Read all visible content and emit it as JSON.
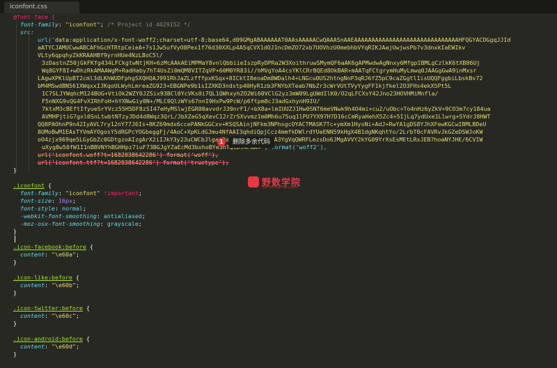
{
  "tab": {
    "title": "iconfont.css"
  },
  "code": {
    "l1": "@font-face {",
    "l2_prop": "font-family",
    "l2_val": "\"iconfont\"",
    "l2_comment": "/* Project id 4029152 */",
    "l3": "src:",
    "l4_prefix": "url('",
    "l4": "data:application/x-font-woff2;charset=utf-8;base64,d09GMgABAAAAAAT0AAsAAAAACwQAAASnAAEAAAAAAAAAAAAAAAAAAAAAAAAAAAAAAHFQGYACDGgqJJId",
    "l5": "aATYCJAMUCwwABCAFhGcHTRtpCeieA+7s1Jw5ufVyO8Pex1f76d30XXLp4A5qCVX1dOJ1ncDmZO72xb7UOVhzU0mebhbVYqRIKJAajUwjwsPb7v3dnxkIaEWIkv",
    "l6": "VLty6qpqhyZkKRAAHBf9yrnHUe4NzLBoC5l/",
    "l7": "3zDastnZ50jGkFKfg434LFCkgtwNtjKH+6zMcAAkAEiMPMaY8vnlQbbiieIszpRyDPRa2W3XoithruwSMymQF6aAK6gAPMwdwAgNnxy6MfgpIBMLgCzlkK6tXB86Uj",
    "l8": "Wq8GYF8I+wDhzRkAMAAWgM+RadHaby7hT4UsZi0mQM8VITZqVP+60M0YR83i//hMVgYoA4csYKlCRrBQEd8OkBAR+mAATqFCtgrymHuMyLmwq0JAAGgGwA9inMxsr",
    "l9": "LAgwXPKlUpBT2cml3dLKhWUDFphgSXQHQAJ991RhJaZLzfffpxKSqx+8ICktI8eoaDm8WDalh4+LNGcu0US2htngNnP3qRJ6fZ5pC9caZGgtl1isUQQFggbiLbskBv72",
    "l10": "bM4MSwdBN561XWqxxIJKqoULWyhLmreaZG923+EBGNPe9b1sIZXKD3ndstp40HyR1zb3FNYbXTeab7NbZr3cWrVUtTVyYygFF1kjfkel2O3FHs4ekX5Pt5L",
    "l11": "1C7SLJYWqhcM124BUG+VtiOk2WZY0JZSix93BCl0YcVKs0i7QL1QWhxyhZO2Wi60VClG2yz3mW09LgUWdIlK0/O2qLFCXsY42Jno23HOVHMiMnfla/",
    "l12": "F5nNXG9vQG4FvXIRhFoH+hYXNwGiy0N+/MLC0QlzWYs67nnI9HxPw9PcW/p6ftpm8cJ3adGxhynH9IU/",
    "l13": "7ktxM3cBEftIfyueSrYVcz55H5DF8zSI47eHyMSlwjEGR08avvdrJ39nrF1/+bX8a+lmIUUZJ1Hw0SNT6meVNwk9h4O4mi+cu2/uObc+To4nHz6yZkV+9CO3m7cy184ua",
    "l14": "AVMHPjtiG7gxl0SnLtwbtNTzyJDd4d8Wqz3QrL/JbXZeG5qXevC12rZrSXvvmzIm0Mh6u75uq1lPU7YX97H7D16cCmRyaHehX5Zc4+5IjLq7ydUxe1Llwrg+5YdrJ8HWT",
    "l15": "QQ8PAOhnP9n42IyAVL7ry12nY77J6Is+8KZ69mdx6ccePANkGGCxv+KSQSAinjNFkm3NPhsgcOYACTMASK7Tc+ymXm1HysNi+AdJ+RwYA1gDS8YJhXFewKGCwIBMLBDeU",
    "l16": "8UMoBwM1EAsTYVmAYOgosY5dRGPcYOGbeggFj/4AoC+XpKLdGJmu4NfAAI3qhdiQpjCcz4mmfkDWlrdYUeENN59kHgX4B1dgNKqhtYo/2LrbT0cFAVRvJkGZeDSWJoKW",
    "l17": "oO4zjx969qe5LGyGbZc0GDtgzoAIzgArX2iIJkY3y23uCWCbJlgai3owaXVkyPQjkJwBA3YgVqQWRFLezsDo6JMgAVVY2kYG09YrXsEsMEtLRxJEB7hoaNYJHE/6CVIW",
    "l18": "uXyg8w50fW1I1nBBVNYhBGHHpz7iuF73BGJgYZaEcMd3bxhoBYe3nTQiD94PAA=",
    "l18_post": "') format('woff2'),",
    "l19": "url('iconfont.woff?t=1682038642286') format('woff'),",
    "l20": "url('iconfont.ttf?t=1682038642286') format('truetype');",
    "l21": "}",
    "l23": ".iconfont",
    "l24_prop": "font-family",
    "l24_val": "\"iconfont\"",
    "l24_imp": "!important",
    "l25_prop": "font-size",
    "l25_val": "16px",
    "l26_prop": "font-style",
    "l26_val": "normal",
    "l27_prop": "-webkit-font-smoothing",
    "l27_val": "antialiased",
    "l28_prop": "-moz-osx-font-smoothing",
    "l28_val": "grayscale",
    "l29": "}",
    "icons": [
      {
        "sel": ".icon-facebook",
        "pseudo": ":before",
        "code": "\"\\e60a\""
      },
      {
        "sel": ".icon-like",
        "pseudo": ":before",
        "code": "\"\\e60b\""
      },
      {
        "sel": ".icon-twitter",
        "pseudo": ":before",
        "code": "\"\\e60c\""
      },
      {
        "sel": ".icon-android",
        "pseudo": ":before",
        "code": "\"\\e60d\""
      }
    ],
    "content_prop": "content"
  },
  "annotation": {
    "badge": "1",
    "text": "删除多余代码"
  },
  "watermark": {
    "brand": "野数学院",
    "sub": "MaiYouXueYuan.com"
  },
  "colors": {
    "bg": "#272822",
    "string": "#e6db74",
    "keyword": "#f92672",
    "prop": "#66d9ef",
    "number": "#ae81ff",
    "selector": "#a6e22e",
    "comment": "#8a887a"
  }
}
